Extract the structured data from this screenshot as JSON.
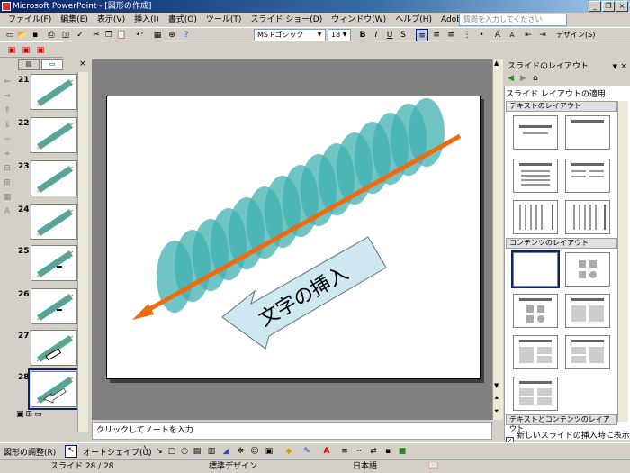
{
  "window": {
    "title": "Microsoft PowerPoint - [図形の作成]",
    "buttons": [
      "_",
      "❐",
      "×"
    ]
  },
  "menu": {
    "items": [
      "ファイル(F)",
      "編集(E)",
      "表示(V)",
      "挿入(I)",
      "書式(O)",
      "ツール(T)",
      "スライド ショー(D)",
      "ウィンドウ(W)",
      "ヘルプ(H)",
      "Adobe PDF(B)"
    ],
    "help_placeholder": "質問を入力してください"
  },
  "format_toolbar": {
    "font": "MS Pゴシック",
    "size": "18",
    "bold": "B",
    "italic": "I",
    "underline": "U",
    "shadow": "S",
    "design": "デザイン(S)"
  },
  "thumbnails": [
    {
      "num": "21"
    },
    {
      "num": "22"
    },
    {
      "num": "23"
    },
    {
      "num": "24"
    },
    {
      "num": "25"
    },
    {
      "num": "26"
    },
    {
      "num": "27"
    },
    {
      "num": "28"
    }
  ],
  "slide": {
    "arrow_text": "文字の挿入",
    "colors": {
      "teal": "#40b0b0",
      "orange": "#f06a10",
      "arrow_fill": "#cde8ee"
    }
  },
  "notes": {
    "placeholder": "クリックしてノートを入力"
  },
  "taskpane": {
    "title": "スライドのレイアウト",
    "apply_label": "スライド レイアウトの適用:",
    "section_text": "テキストのレイアウト",
    "section_content": "コンテンツのレイアウト",
    "section_text_content": "テキストとコンテンツのレイアウト",
    "show_checkbox": "新しいスライドの挿入時に表示する"
  },
  "drawbar": {
    "draw_menu": "図形の調整(R)",
    "autoshape": "オートシェイプ(U)"
  },
  "status": {
    "slide": "スライド 28 / 28",
    "design": "標準デザイン",
    "lang": "日本語"
  }
}
